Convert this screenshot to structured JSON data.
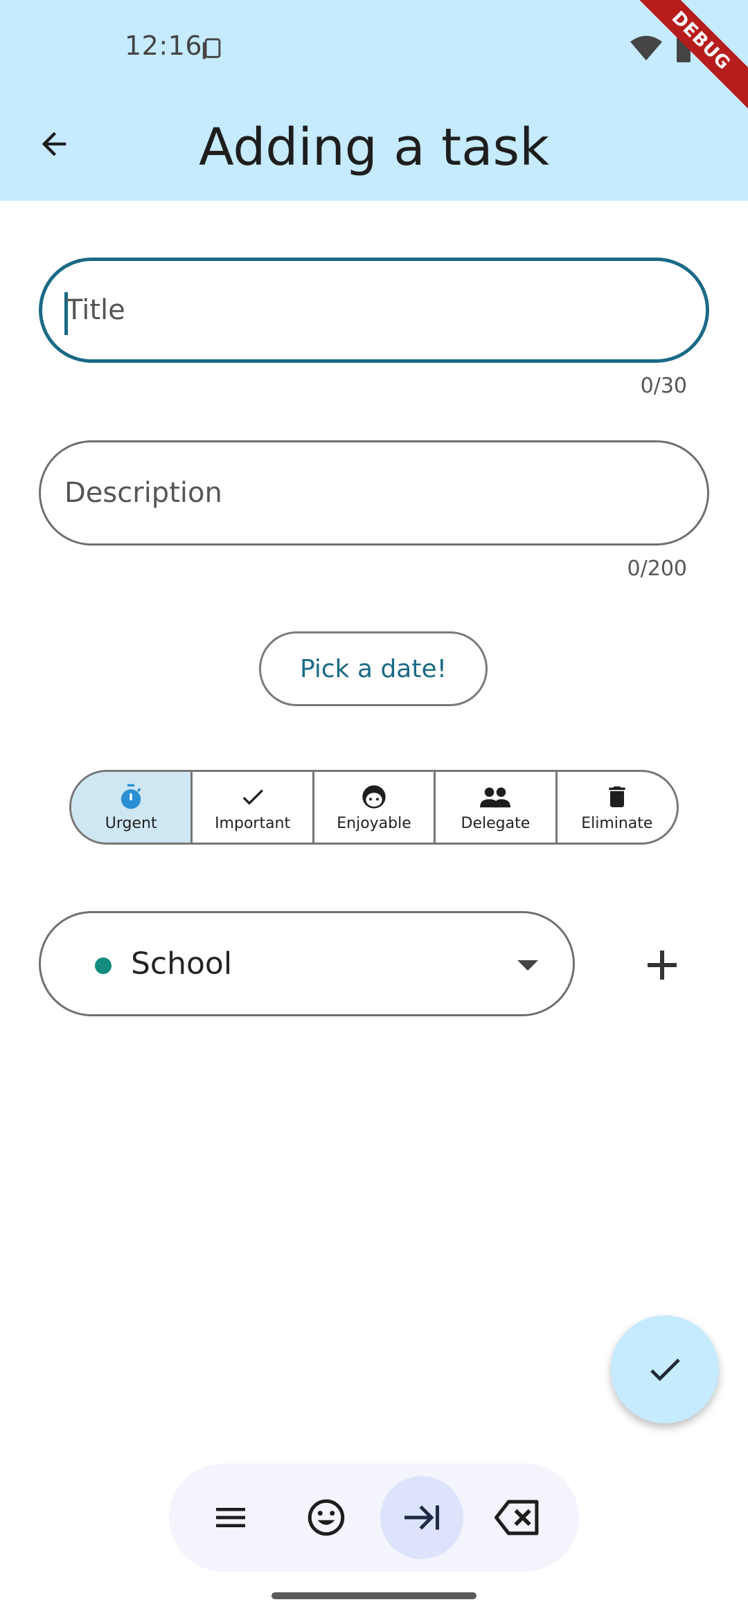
{
  "status_bar": {
    "time": "12:16"
  },
  "debug_ribbon": "DEBUG",
  "app_bar": {
    "title": "Adding a task"
  },
  "form": {
    "title_field": {
      "placeholder": "Title",
      "value": "",
      "counter": "0/30"
    },
    "description_field": {
      "placeholder": "Description",
      "value": "",
      "counter": "0/200"
    },
    "pick_date_label": "Pick a date!",
    "priority_segments": [
      {
        "label": "Urgent",
        "icon": "timer-icon",
        "selected": true
      },
      {
        "label": "Important",
        "icon": "check-icon",
        "selected": false
      },
      {
        "label": "Enjoyable",
        "icon": "face-icon",
        "selected": false
      },
      {
        "label": "Delegate",
        "icon": "people-icon",
        "selected": false
      },
      {
        "label": "Eliminate",
        "icon": "trash-icon",
        "selected": false
      }
    ],
    "category": {
      "value": "School",
      "dot_color": "#128C7E"
    }
  },
  "colors": {
    "accent": "#1a6a86",
    "appbar": "#C6EAFE",
    "selected_segment": "#CFE6F3"
  },
  "keyboard_toolbar": {
    "icons": [
      "menu-icon",
      "emoji-icon",
      "tab-icon",
      "backspace-icon"
    ]
  }
}
